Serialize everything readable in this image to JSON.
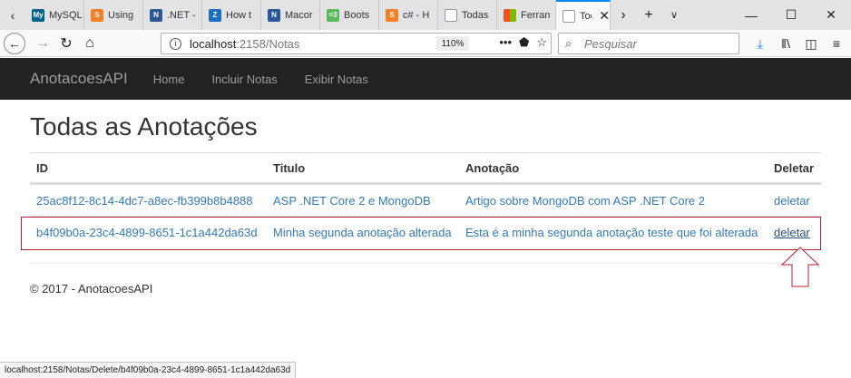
{
  "browser": {
    "tabs": [
      {
        "label": "MySQL",
        "fav_color": "#00618a",
        "fav_icon": "mysql-icon",
        "fav_text": "My"
      },
      {
        "label": "Using",
        "fav_color": "#f48024",
        "fav_icon": "stackoverflow-icon",
        "fav_text": "S"
      },
      {
        "label": ".NET -",
        "fav_color": "#2b579a",
        "fav_icon": "dotnet-icon",
        "fav_text": "N"
      },
      {
        "label": "How t",
        "fav_color": "#1d6fbd",
        "fav_icon": "howto-icon",
        "fav_text": "Z"
      },
      {
        "label": "Macor",
        "fav_color": "#2b579a",
        "fav_icon": "dotnet-icon",
        "fav_text": "N"
      },
      {
        "label": "Boots",
        "fav_color": "#5cb85c",
        "fav_icon": "bootstrap-icon",
        "fav_text": "=3"
      },
      {
        "label": "c# - H",
        "fav_color": "#f48024",
        "fav_icon": "stackoverflow-icon",
        "fav_text": "S"
      },
      {
        "label": "Todas",
        "fav_color": "#bbbbbb",
        "fav_icon": "page-icon",
        "fav_text": ""
      },
      {
        "label": "Ferran",
        "fav_color": "#f25022",
        "fav_icon": "microsoft-icon",
        "fav_text": ""
      }
    ],
    "active_tab_label": "Too",
    "url_host": "localhost",
    "url_path": ":2158/Notas",
    "zoom": "110%",
    "search_placeholder": "Pesquisar",
    "status_text": "localhost:2158/Notas/Delete/b4f09b0a-23c4-4899-8651-1c1a442da63d",
    "accent_color": "#0a84ff"
  },
  "app": {
    "brand": "AnotacoesAPI",
    "nav": [
      "Home",
      "Incluir Notas",
      "Exibir Notas"
    ]
  },
  "page": {
    "title": "Todas as Anotações",
    "headers": [
      "ID",
      "Titulo",
      "Anotação",
      "Deletar"
    ],
    "rows": [
      {
        "id": "25ac8f12-8c14-4dc7-a8ec-fb399b8b4888",
        "titulo": "ASP .NET Core 2 e MongoDB",
        "anotacao": "Artigo sobre MongoDB com ASP .NET Core 2",
        "acao": "deletar"
      },
      {
        "id": "b4f09b0a-23c4-4899-8651-1c1a442da63d",
        "titulo": "Minha segunda anotação alterada",
        "anotacao": "Esta é a minha segunda anotação teste que foi alterada",
        "acao": "deletar"
      }
    ],
    "footer": "© 2017 - AnotacoesAPI",
    "link_color": "#337ab7",
    "highlight_color": "#b32033"
  }
}
